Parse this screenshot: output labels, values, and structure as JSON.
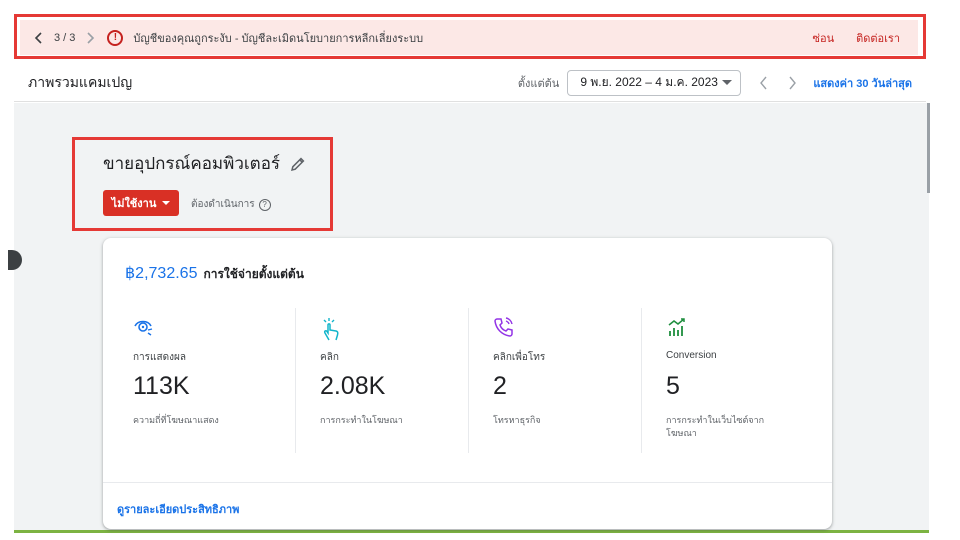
{
  "alert": {
    "counter": "3 / 3",
    "message": "บัญชีของคุณถูกระงับ - บัญชีละเมิดนโยบายการหลีกเลี่ยงระบบ",
    "hide_label": "ซ่อน",
    "contact_label": "ติดต่อเรา"
  },
  "header": {
    "title": "ภาพรวมแคมเปญ",
    "range_label": "ตั้งแต่ต้น",
    "date_range": "9 พ.ย. 2022 – 4 ม.ค. 2023",
    "show_last_label": "แสดงค่า 30 วันล่าสุด"
  },
  "campaign": {
    "name": "ขายอุปกรณ์คอมพิวเตอร์",
    "status_label": "ไม่ใช้งาน",
    "action_needed": "ต้องดำเนินการ"
  },
  "card": {
    "spend_amount": "฿2,732.65",
    "spend_label": "การใช้จ่ายตั้งแต่ต้น",
    "metrics": [
      {
        "icon": "impressions-eye-icon",
        "label": "การแสดงผล",
        "value": "113K",
        "desc": "ความถี่ที่โฆษณาแสดง",
        "color": "#1a73e8"
      },
      {
        "icon": "click-hand-icon",
        "label": "คลิก",
        "value": "2.08K",
        "desc": "การกระทำในโฆษณา",
        "color": "#12b5cb"
      },
      {
        "icon": "phone-call-icon",
        "label": "คลิกเพื่อโทร",
        "value": "2",
        "desc": "โทรหาธุรกิจ",
        "color": "#9334e6"
      },
      {
        "icon": "conversion-chart-icon",
        "label": "Conversion",
        "value": "5",
        "desc": "การกระทำในเว็บไซต์จากโฆษณา",
        "color": "#1e8e3e"
      }
    ],
    "footer_link": "ดูรายละเอียดประสิทธิภาพ"
  }
}
